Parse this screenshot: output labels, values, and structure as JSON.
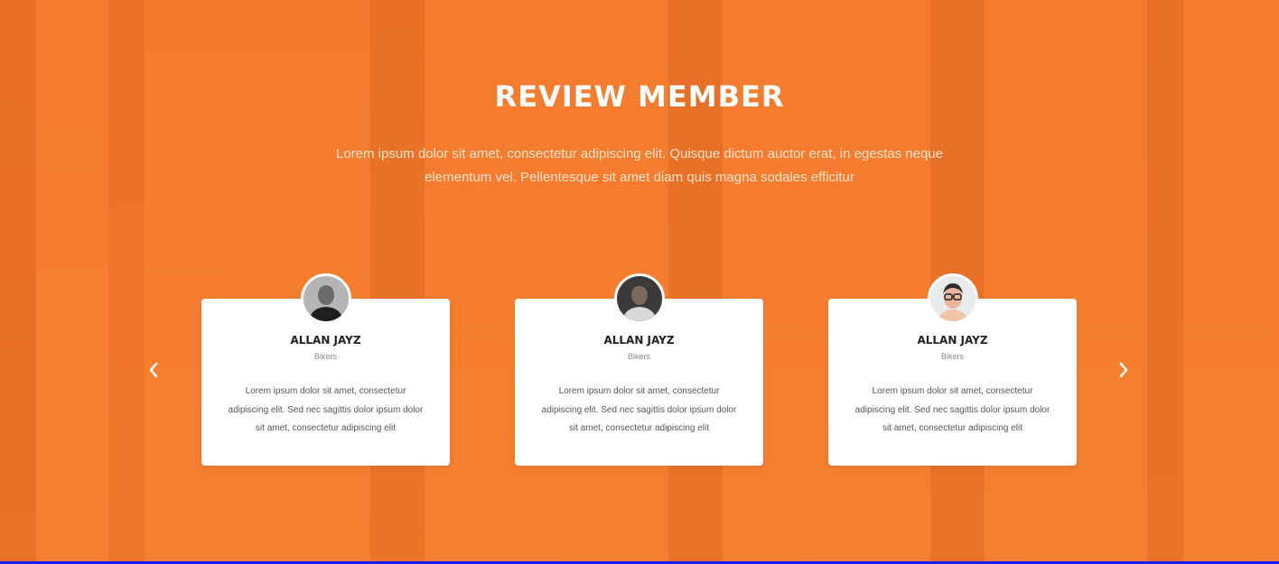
{
  "section": {
    "title": "REVIEW MEMBER",
    "subtitle": "Lorem ipsum dolor sit amet, consectetur adipiscing elit. Quisque dictum auctor erat, in egestas neque elementum vel. Pellentesque sit amet diam quis magna sodales efficitur"
  },
  "carousel": {
    "prev_icon": "chevron-left-icon",
    "next_icon": "chevron-right-icon",
    "cards": [
      {
        "avatar_icon": "avatar-photo",
        "name": "ALLAN JAYZ",
        "role": "Bikers",
        "text": "Lorem ipsum dolor sit amet, consectetur adipiscing elit. Sed nec sagittis dolor ipsum dolor sit amet, consectetur adipiscing elit"
      },
      {
        "avatar_icon": "avatar-photo",
        "name": "ALLAN JAYZ",
        "role": "Bikers",
        "text": "Lorem ipsum dolor sit amet, consectetur adipiscing elit. Sed nec sagittis dolor ipsum dolor sit amet, consectetur adipiscing elit"
      },
      {
        "avatar_icon": "avatar-photo",
        "name": "ALLAN JAYZ",
        "role": "Bikers",
        "text": "Lorem ipsum dolor sit amet, consectetur adipiscing elit. Sed nec sagittis dolor ipsum dolor sit amet, consectetur adipiscing elit"
      }
    ]
  },
  "colors": {
    "background": "#f47a2c",
    "card": "#ffffff",
    "title": "#ffffff"
  }
}
